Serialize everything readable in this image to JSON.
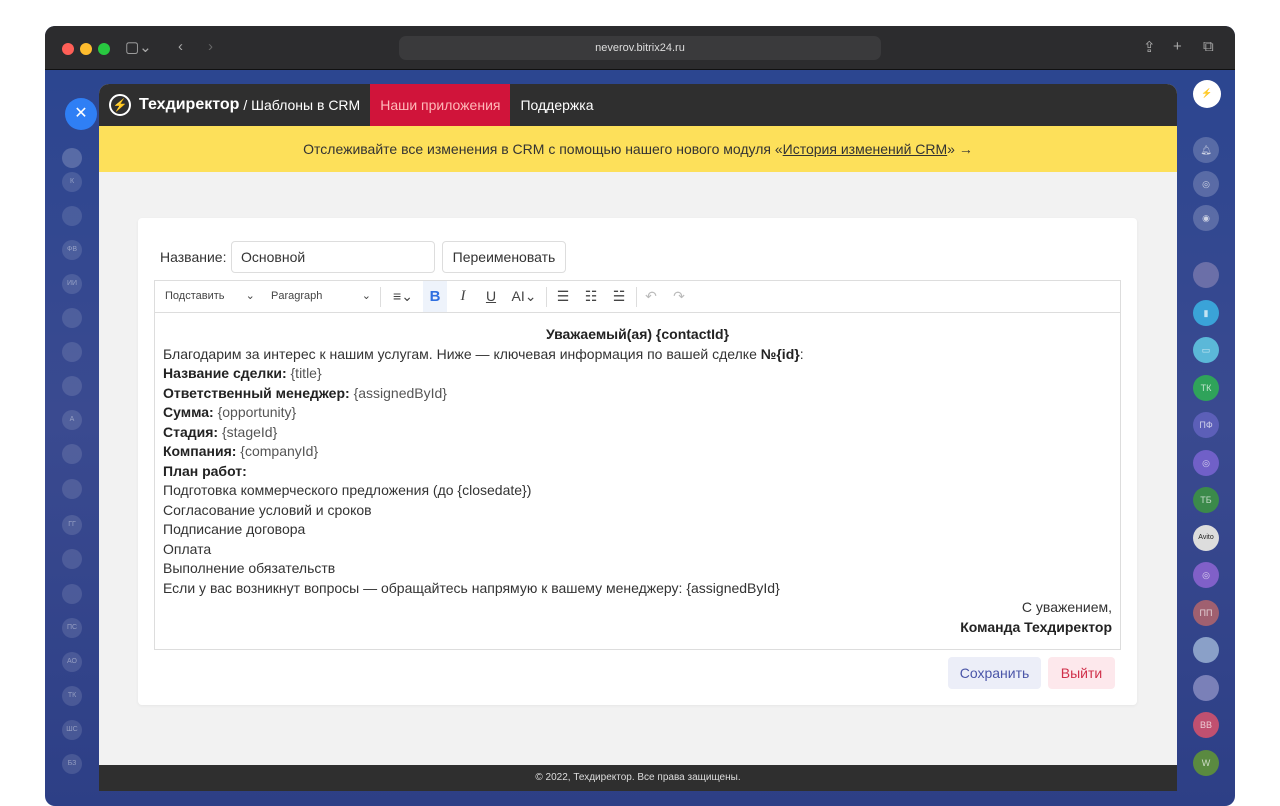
{
  "browser": {
    "url": "neverov.bitrix24.ru"
  },
  "left_sidebar": {
    "items": [
      "К",
      "ФВ",
      "ИИ",
      "А",
      "ГГ",
      "ПС",
      "АО",
      "ТК",
      "ШС",
      "БЗ"
    ]
  },
  "right_sidebar": {
    "items": [
      "ТК",
      "ПФ",
      "ТБ",
      "Avito",
      "ПП",
      "ВВ",
      "W"
    ]
  },
  "header": {
    "brand": "Техдиректор",
    "crumb": "/ Шаблоны в CRM",
    "nav": [
      "Наши приложения",
      "Поддержка"
    ]
  },
  "banner": {
    "text_before": "Отслеживайте все изменения в CRM с помощью нашего нового модуля «",
    "link": "История изменений CRM",
    "text_after": "» →"
  },
  "form": {
    "name_label": "Название:",
    "name_value": "Основной",
    "rename_label": "Переименовать"
  },
  "toolbar": {
    "insert": "Подставить",
    "block": "Paragraph",
    "bold": "B",
    "italic": "I",
    "underline": "U",
    "font": "AI"
  },
  "content": {
    "greeting": "Уважаемый(ая) {contactId}",
    "intro": "Благодарим за интерес к нашим услугам. Ниже — ключевая информация по вашей сделке ",
    "intro_id": "№{id}",
    "intro_end": ":",
    "fields": [
      {
        "label": "Название сделки:",
        "value": "{title}"
      },
      {
        "label": "Ответственный менеджер:",
        "value": "{assignedById}"
      },
      {
        "label": "Сумма:",
        "value": "{opportunity}"
      },
      {
        "label": "Стадия:",
        "value": "{stageId}"
      },
      {
        "label": "Компания:",
        "value": "{companyId}"
      }
    ],
    "plan_label": "План работ:",
    "plan": [
      "Подготовка коммерческого предложения (до {closedate})",
      "Согласование условий и сроков",
      "Подписание договора",
      "Оплата",
      "Выполнение обязательств"
    ],
    "closing": "Если у вас возникнут вопросы — обращайтесь напрямую к вашему менеджеру: {assignedById}",
    "regards": "С уважением,",
    "signature": "Команда Техдиректор"
  },
  "actions": {
    "save": "Сохранить",
    "exit": "Выйти"
  },
  "footer": "© 2022, Техдиректор. Все права защищены."
}
